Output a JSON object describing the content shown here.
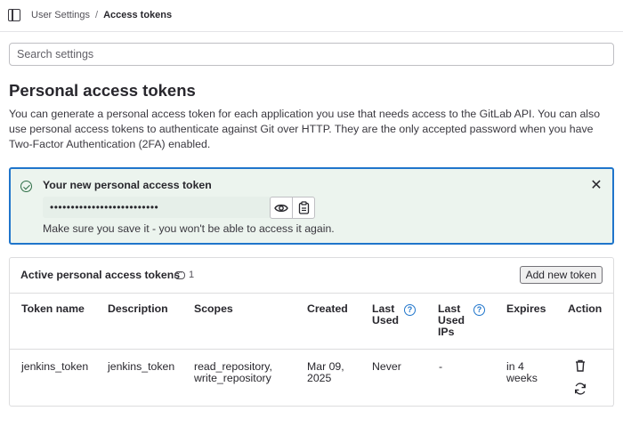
{
  "breadcrumb": {
    "parent": "User Settings",
    "separator": "/",
    "current": "Access tokens"
  },
  "search": {
    "placeholder": "Search settings"
  },
  "page": {
    "title": "Personal access tokens",
    "description": "You can generate a personal access token for each application you use that needs access to the GitLab API. You can also use personal access tokens to authenticate against Git over HTTP. They are the only accepted password when you have Two-Factor Authentication (2FA) enabled."
  },
  "new_token_alert": {
    "title": "Your new personal access token",
    "masked_value": "••••••••••••••••••••••••••",
    "note": "Make sure you save it - you won't be able to access it again.",
    "close_glyph": "✕",
    "icons": [
      "check-circle-icon",
      "close-icon",
      "eye-icon",
      "clipboard-icon"
    ]
  },
  "active_tokens": {
    "title": "Active personal access tokens",
    "count": "1",
    "add_button": "Add new token",
    "columns": {
      "name": "Token name",
      "description": "Description",
      "scopes": "Scopes",
      "created": "Created",
      "last_used": "Last Used",
      "last_used_ips": "Last Used IPs",
      "expires": "Expires",
      "action": "Action"
    },
    "rows": [
      {
        "name": "jenkins_token",
        "description": "jenkins_token",
        "scopes": "read_repository, write_repository",
        "created": "Mar 09, 2025",
        "last_used": "Never",
        "last_used_ips": "-",
        "expires": "in 4 weeks"
      }
    ],
    "help_glyph": "?",
    "row_actions": [
      "trash-icon",
      "rotate-icon"
    ]
  },
  "colors": {
    "alert_bg": "#ecf4ee",
    "alert_border": "#1f75cb",
    "success_icon": "#2d6e46",
    "help_icon": "#1f75cb"
  }
}
